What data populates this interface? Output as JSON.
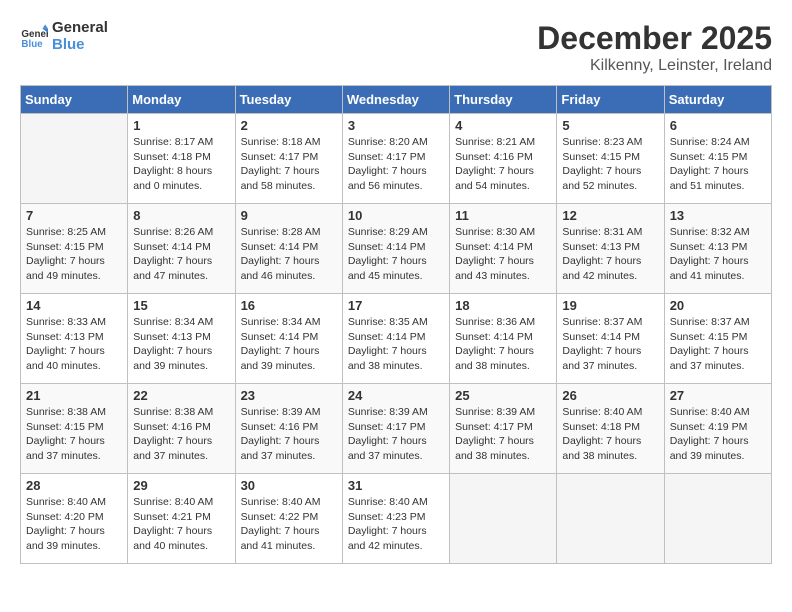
{
  "logo": {
    "line1": "General",
    "line2": "Blue"
  },
  "title": "December 2025",
  "subtitle": "Kilkenny, Leinster, Ireland",
  "days_of_week": [
    "Sunday",
    "Monday",
    "Tuesday",
    "Wednesday",
    "Thursday",
    "Friday",
    "Saturday"
  ],
  "weeks": [
    [
      {
        "day": "",
        "empty": true
      },
      {
        "day": "1",
        "sunrise": "8:17 AM",
        "sunset": "4:18 PM",
        "daylight": "8 hours and 0 minutes."
      },
      {
        "day": "2",
        "sunrise": "8:18 AM",
        "sunset": "4:17 PM",
        "daylight": "7 hours and 58 minutes."
      },
      {
        "day": "3",
        "sunrise": "8:20 AM",
        "sunset": "4:17 PM",
        "daylight": "7 hours and 56 minutes."
      },
      {
        "day": "4",
        "sunrise": "8:21 AM",
        "sunset": "4:16 PM",
        "daylight": "7 hours and 54 minutes."
      },
      {
        "day": "5",
        "sunrise": "8:23 AM",
        "sunset": "4:15 PM",
        "daylight": "7 hours and 52 minutes."
      },
      {
        "day": "6",
        "sunrise": "8:24 AM",
        "sunset": "4:15 PM",
        "daylight": "7 hours and 51 minutes."
      }
    ],
    [
      {
        "day": "7",
        "sunrise": "8:25 AM",
        "sunset": "4:15 PM",
        "daylight": "7 hours and 49 minutes."
      },
      {
        "day": "8",
        "sunrise": "8:26 AM",
        "sunset": "4:14 PM",
        "daylight": "7 hours and 47 minutes."
      },
      {
        "day": "9",
        "sunrise": "8:28 AM",
        "sunset": "4:14 PM",
        "daylight": "7 hours and 46 minutes."
      },
      {
        "day": "10",
        "sunrise": "8:29 AM",
        "sunset": "4:14 PM",
        "daylight": "7 hours and 45 minutes."
      },
      {
        "day": "11",
        "sunrise": "8:30 AM",
        "sunset": "4:14 PM",
        "daylight": "7 hours and 43 minutes."
      },
      {
        "day": "12",
        "sunrise": "8:31 AM",
        "sunset": "4:13 PM",
        "daylight": "7 hours and 42 minutes."
      },
      {
        "day": "13",
        "sunrise": "8:32 AM",
        "sunset": "4:13 PM",
        "daylight": "7 hours and 41 minutes."
      }
    ],
    [
      {
        "day": "14",
        "sunrise": "8:33 AM",
        "sunset": "4:13 PM",
        "daylight": "7 hours and 40 minutes."
      },
      {
        "day": "15",
        "sunrise": "8:34 AM",
        "sunset": "4:13 PM",
        "daylight": "7 hours and 39 minutes."
      },
      {
        "day": "16",
        "sunrise": "8:34 AM",
        "sunset": "4:14 PM",
        "daylight": "7 hours and 39 minutes."
      },
      {
        "day": "17",
        "sunrise": "8:35 AM",
        "sunset": "4:14 PM",
        "daylight": "7 hours and 38 minutes."
      },
      {
        "day": "18",
        "sunrise": "8:36 AM",
        "sunset": "4:14 PM",
        "daylight": "7 hours and 38 minutes."
      },
      {
        "day": "19",
        "sunrise": "8:37 AM",
        "sunset": "4:14 PM",
        "daylight": "7 hours and 37 minutes."
      },
      {
        "day": "20",
        "sunrise": "8:37 AM",
        "sunset": "4:15 PM",
        "daylight": "7 hours and 37 minutes."
      }
    ],
    [
      {
        "day": "21",
        "sunrise": "8:38 AM",
        "sunset": "4:15 PM",
        "daylight": "7 hours and 37 minutes."
      },
      {
        "day": "22",
        "sunrise": "8:38 AM",
        "sunset": "4:16 PM",
        "daylight": "7 hours and 37 minutes."
      },
      {
        "day": "23",
        "sunrise": "8:39 AM",
        "sunset": "4:16 PM",
        "daylight": "7 hours and 37 minutes."
      },
      {
        "day": "24",
        "sunrise": "8:39 AM",
        "sunset": "4:17 PM",
        "daylight": "7 hours and 37 minutes."
      },
      {
        "day": "25",
        "sunrise": "8:39 AM",
        "sunset": "4:17 PM",
        "daylight": "7 hours and 38 minutes."
      },
      {
        "day": "26",
        "sunrise": "8:40 AM",
        "sunset": "4:18 PM",
        "daylight": "7 hours and 38 minutes."
      },
      {
        "day": "27",
        "sunrise": "8:40 AM",
        "sunset": "4:19 PM",
        "daylight": "7 hours and 39 minutes."
      }
    ],
    [
      {
        "day": "28",
        "sunrise": "8:40 AM",
        "sunset": "4:20 PM",
        "daylight": "7 hours and 39 minutes."
      },
      {
        "day": "29",
        "sunrise": "8:40 AM",
        "sunset": "4:21 PM",
        "daylight": "7 hours and 40 minutes."
      },
      {
        "day": "30",
        "sunrise": "8:40 AM",
        "sunset": "4:22 PM",
        "daylight": "7 hours and 41 minutes."
      },
      {
        "day": "31",
        "sunrise": "8:40 AM",
        "sunset": "4:23 PM",
        "daylight": "7 hours and 42 minutes."
      },
      {
        "day": "",
        "empty": true
      },
      {
        "day": "",
        "empty": true
      },
      {
        "day": "",
        "empty": true
      }
    ]
  ]
}
